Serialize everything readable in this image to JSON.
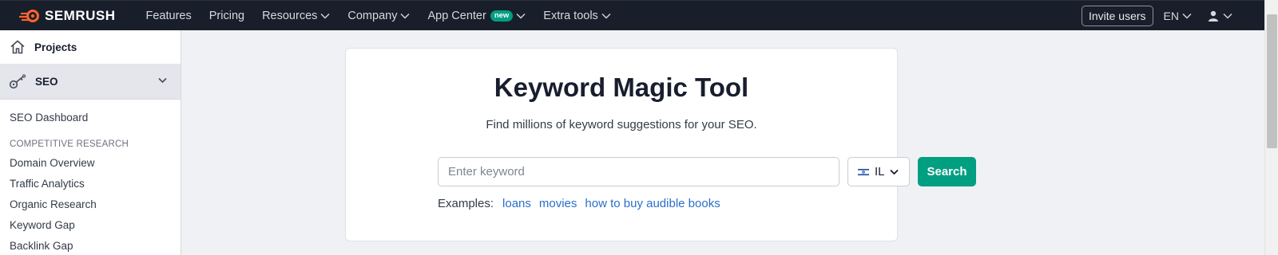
{
  "brand": {
    "name": "SEMRUSH",
    "accent": "#ff642d"
  },
  "topnav": {
    "items": [
      {
        "label": "Features",
        "dropdown": false
      },
      {
        "label": "Pricing",
        "dropdown": false
      },
      {
        "label": "Resources",
        "dropdown": true
      },
      {
        "label": "Company",
        "dropdown": true
      },
      {
        "label": "App Center",
        "dropdown": true,
        "badge": "new"
      },
      {
        "label": "Extra tools",
        "dropdown": true
      }
    ],
    "invite_label": "Invite users",
    "lang": "EN",
    "user_icon": "user-icon"
  },
  "sidebar": {
    "projects_label": "Projects",
    "seo_label": "SEO",
    "dashboard_label": "SEO Dashboard",
    "section_label": "COMPETITIVE RESEARCH",
    "links": [
      "Domain Overview",
      "Traffic Analytics",
      "Organic Research",
      "Keyword Gap",
      "Backlink Gap"
    ]
  },
  "main": {
    "title": "Keyword Magic Tool",
    "subtitle": "Find millions of keyword suggestions for your SEO.",
    "input_placeholder": "Enter keyword",
    "input_value": "",
    "country_code": "IL",
    "search_label": "Search",
    "examples_label": "Examples:",
    "examples": [
      "loans",
      "movies",
      "how to buy audible books"
    ]
  },
  "colors": {
    "topbar_bg": "#181e2a",
    "primary_button": "#009f81",
    "link": "#2c6ecb",
    "badge": "#009f81"
  }
}
